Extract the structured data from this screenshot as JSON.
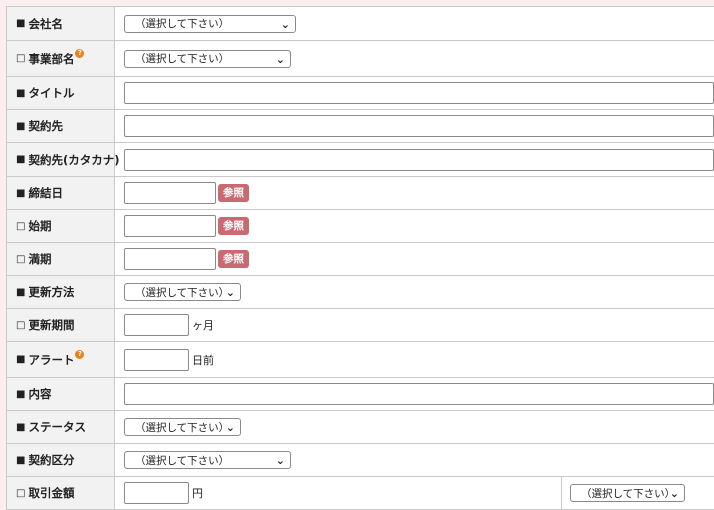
{
  "select_placeholder": "（選択して下さい）",
  "ref_label": "参照",
  "marks": {
    "required": "■",
    "optional": "□"
  },
  "help_glyph": "?",
  "rows": {
    "company": {
      "label": "会社名"
    },
    "department": {
      "label": "事業部名"
    },
    "title": {
      "label": "タイトル"
    },
    "contractor": {
      "label": "契約先"
    },
    "contractor_kana": {
      "label": "契約先(カタカナ)"
    },
    "conclusion_date": {
      "label": "締結日"
    },
    "start_date": {
      "label": "始期"
    },
    "end_date": {
      "label": "満期"
    },
    "renewal_method": {
      "label": "更新方法"
    },
    "renewal_period": {
      "label": "更新期間",
      "unit": "ヶ月"
    },
    "alert": {
      "label": "アラート",
      "unit": "日前"
    },
    "content": {
      "label": "内容"
    },
    "status": {
      "label": "ステータス"
    },
    "contract_category": {
      "label": "契約区分"
    },
    "transaction_amount": {
      "label": "取引金額",
      "unit": "円"
    }
  }
}
